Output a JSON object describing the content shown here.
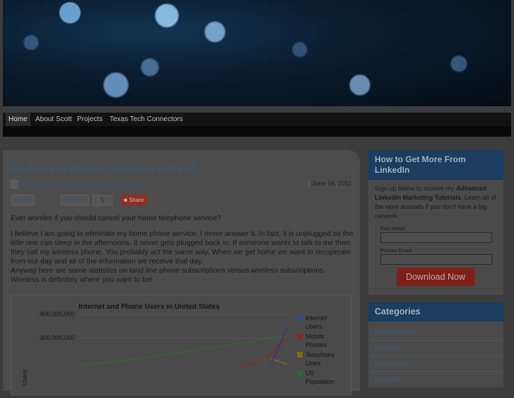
{
  "nav": {
    "items": [
      "Home",
      "About Scott",
      "Projects",
      "Texas Tech Connectors"
    ]
  },
  "post": {
    "title": "Wireless and Wireline Subscribers in the US",
    "categories": "Featured,  marketing automation,  Social Media",
    "date": "June 16, 2011",
    "like_label": "Like",
    "tweet_label": "Tweet",
    "tweet_count": "5",
    "share_label": "Share",
    "question": "Ever wonder if you should cancel your home telephone service?",
    "paragraph1": "I believe I am going to eliminate my home phone service. I never answer it. In fact, it is unplugged so the little one can sleep in the afternoons. It never gets plugged back in. If someone wants to talk to me then they call my wireless phone. You probably act the same way. When we get home we want to recuperate from our day and all of the information we receive that day.",
    "paragraph2": "Anyway here are some statistics on land line phone subscriptions versus wireless subscriptions. Wireless is definitely where you want to be!"
  },
  "chart_data": {
    "type": "line",
    "title": "Internet and Phone Users in United States",
    "ylabel": "Users",
    "yticks": [
      {
        "label": "400,000,000",
        "value": 400000000
      },
      {
        "label": "300,000,000",
        "value": 300000000
      }
    ],
    "ylim": [
      0,
      420000000
    ],
    "x": [
      0,
      1,
      2,
      3,
      4,
      5,
      6,
      7,
      8,
      9,
      10,
      11,
      12,
      13
    ],
    "series": [
      {
        "name": "Internet Users",
        "color": "#2d4f8f",
        "values": [
          null,
          null,
          null,
          null,
          null,
          null,
          null,
          null,
          null,
          null,
          null,
          null,
          200000000,
          215000000
        ]
      },
      {
        "name": "Mobile Phones",
        "color": "#8a2a1c",
        "values": [
          null,
          null,
          null,
          null,
          null,
          null,
          null,
          null,
          null,
          null,
          180000000,
          195000000,
          230000000,
          300000000
        ]
      },
      {
        "name": "Telephone Lines",
        "color": "#8a6a10",
        "values": [
          null,
          null,
          null,
          null,
          null,
          null,
          null,
          null,
          null,
          null,
          null,
          null,
          210000000,
          190000000
        ]
      },
      {
        "name": "US Populaton",
        "color": "#2d6a2a",
        "values": [
          185000000,
          190000000,
          198000000,
          205000000,
          215000000,
          225000000,
          235000000,
          245000000,
          255000000,
          265000000,
          275000000,
          288000000,
          300000000,
          308000000
        ]
      },
      {
        "name": "",
        "color": "#4a2a7a",
        "values": [
          null,
          null,
          null,
          null,
          null,
          null,
          null,
          null,
          null,
          null,
          null,
          null,
          190000000,
          340000000
        ]
      }
    ]
  },
  "sidebar": {
    "promo": {
      "title": "How to Get More From LinkedIn",
      "text_before": "Sign up below to receive my ",
      "text_bold": "Advanced LinkedIn Marketing Tutorials",
      "text_after": ". Learn all of the work arounds if you don't have a big network.",
      "first_name_label": "First Name:",
      "email_label": "Primary Email:",
      "download_label": "Download Now"
    },
    "categories": {
      "title": "Categories",
      "items": [
        "best practices",
        "Featured",
        "GoogleDocs",
        "LinkedIn"
      ]
    }
  }
}
